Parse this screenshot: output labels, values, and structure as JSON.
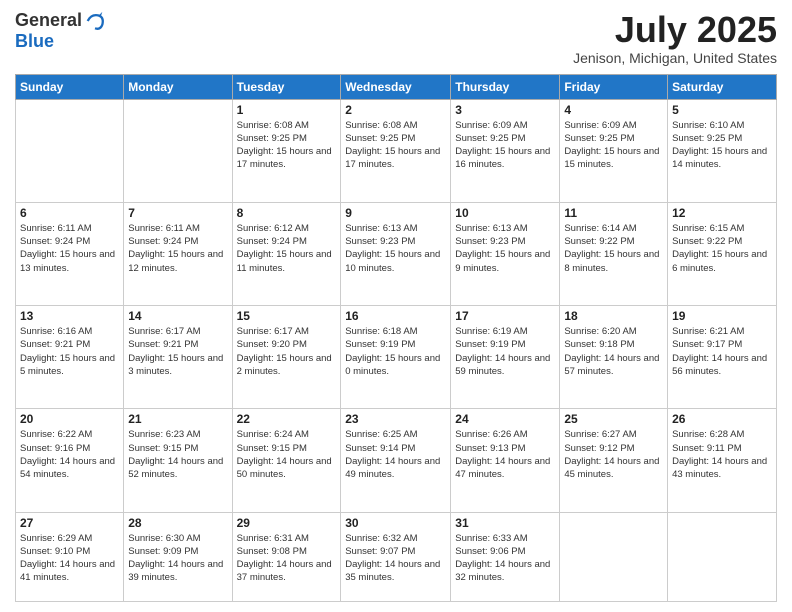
{
  "header": {
    "logo": {
      "line1": "General",
      "line2": "Blue"
    },
    "title": "July 2025",
    "subtitle": "Jenison, Michigan, United States"
  },
  "weekdays": [
    "Sunday",
    "Monday",
    "Tuesday",
    "Wednesday",
    "Thursday",
    "Friday",
    "Saturday"
  ],
  "weeks": [
    [
      {
        "day": "",
        "info": ""
      },
      {
        "day": "",
        "info": ""
      },
      {
        "day": "1",
        "sunrise": "6:08 AM",
        "sunset": "9:25 PM",
        "daylight": "15 hours and 17 minutes."
      },
      {
        "day": "2",
        "sunrise": "6:08 AM",
        "sunset": "9:25 PM",
        "daylight": "15 hours and 17 minutes."
      },
      {
        "day": "3",
        "sunrise": "6:09 AM",
        "sunset": "9:25 PM",
        "daylight": "15 hours and 16 minutes."
      },
      {
        "day": "4",
        "sunrise": "6:09 AM",
        "sunset": "9:25 PM",
        "daylight": "15 hours and 15 minutes."
      },
      {
        "day": "5",
        "sunrise": "6:10 AM",
        "sunset": "9:25 PM",
        "daylight": "15 hours and 14 minutes."
      }
    ],
    [
      {
        "day": "6",
        "sunrise": "6:11 AM",
        "sunset": "9:24 PM",
        "daylight": "15 hours and 13 minutes."
      },
      {
        "day": "7",
        "sunrise": "6:11 AM",
        "sunset": "9:24 PM",
        "daylight": "15 hours and 12 minutes."
      },
      {
        "day": "8",
        "sunrise": "6:12 AM",
        "sunset": "9:24 PM",
        "daylight": "15 hours and 11 minutes."
      },
      {
        "day": "9",
        "sunrise": "6:13 AM",
        "sunset": "9:23 PM",
        "daylight": "15 hours and 10 minutes."
      },
      {
        "day": "10",
        "sunrise": "6:13 AM",
        "sunset": "9:23 PM",
        "daylight": "15 hours and 9 minutes."
      },
      {
        "day": "11",
        "sunrise": "6:14 AM",
        "sunset": "9:22 PM",
        "daylight": "15 hours and 8 minutes."
      },
      {
        "day": "12",
        "sunrise": "6:15 AM",
        "sunset": "9:22 PM",
        "daylight": "15 hours and 6 minutes."
      }
    ],
    [
      {
        "day": "13",
        "sunrise": "6:16 AM",
        "sunset": "9:21 PM",
        "daylight": "15 hours and 5 minutes."
      },
      {
        "day": "14",
        "sunrise": "6:17 AM",
        "sunset": "9:21 PM",
        "daylight": "15 hours and 3 minutes."
      },
      {
        "day": "15",
        "sunrise": "6:17 AM",
        "sunset": "9:20 PM",
        "daylight": "15 hours and 2 minutes."
      },
      {
        "day": "16",
        "sunrise": "6:18 AM",
        "sunset": "9:19 PM",
        "daylight": "15 hours and 0 minutes."
      },
      {
        "day": "17",
        "sunrise": "6:19 AM",
        "sunset": "9:19 PM",
        "daylight": "14 hours and 59 minutes."
      },
      {
        "day": "18",
        "sunrise": "6:20 AM",
        "sunset": "9:18 PM",
        "daylight": "14 hours and 57 minutes."
      },
      {
        "day": "19",
        "sunrise": "6:21 AM",
        "sunset": "9:17 PM",
        "daylight": "14 hours and 56 minutes."
      }
    ],
    [
      {
        "day": "20",
        "sunrise": "6:22 AM",
        "sunset": "9:16 PM",
        "daylight": "14 hours and 54 minutes."
      },
      {
        "day": "21",
        "sunrise": "6:23 AM",
        "sunset": "9:15 PM",
        "daylight": "14 hours and 52 minutes."
      },
      {
        "day": "22",
        "sunrise": "6:24 AM",
        "sunset": "9:15 PM",
        "daylight": "14 hours and 50 minutes."
      },
      {
        "day": "23",
        "sunrise": "6:25 AM",
        "sunset": "9:14 PM",
        "daylight": "14 hours and 49 minutes."
      },
      {
        "day": "24",
        "sunrise": "6:26 AM",
        "sunset": "9:13 PM",
        "daylight": "14 hours and 47 minutes."
      },
      {
        "day": "25",
        "sunrise": "6:27 AM",
        "sunset": "9:12 PM",
        "daylight": "14 hours and 45 minutes."
      },
      {
        "day": "26",
        "sunrise": "6:28 AM",
        "sunset": "9:11 PM",
        "daylight": "14 hours and 43 minutes."
      }
    ],
    [
      {
        "day": "27",
        "sunrise": "6:29 AM",
        "sunset": "9:10 PM",
        "daylight": "14 hours and 41 minutes."
      },
      {
        "day": "28",
        "sunrise": "6:30 AM",
        "sunset": "9:09 PM",
        "daylight": "14 hours and 39 minutes."
      },
      {
        "day": "29",
        "sunrise": "6:31 AM",
        "sunset": "9:08 PM",
        "daylight": "14 hours and 37 minutes."
      },
      {
        "day": "30",
        "sunrise": "6:32 AM",
        "sunset": "9:07 PM",
        "daylight": "14 hours and 35 minutes."
      },
      {
        "day": "31",
        "sunrise": "6:33 AM",
        "sunset": "9:06 PM",
        "daylight": "14 hours and 32 minutes."
      },
      {
        "day": "",
        "info": ""
      },
      {
        "day": "",
        "info": ""
      }
    ]
  ]
}
